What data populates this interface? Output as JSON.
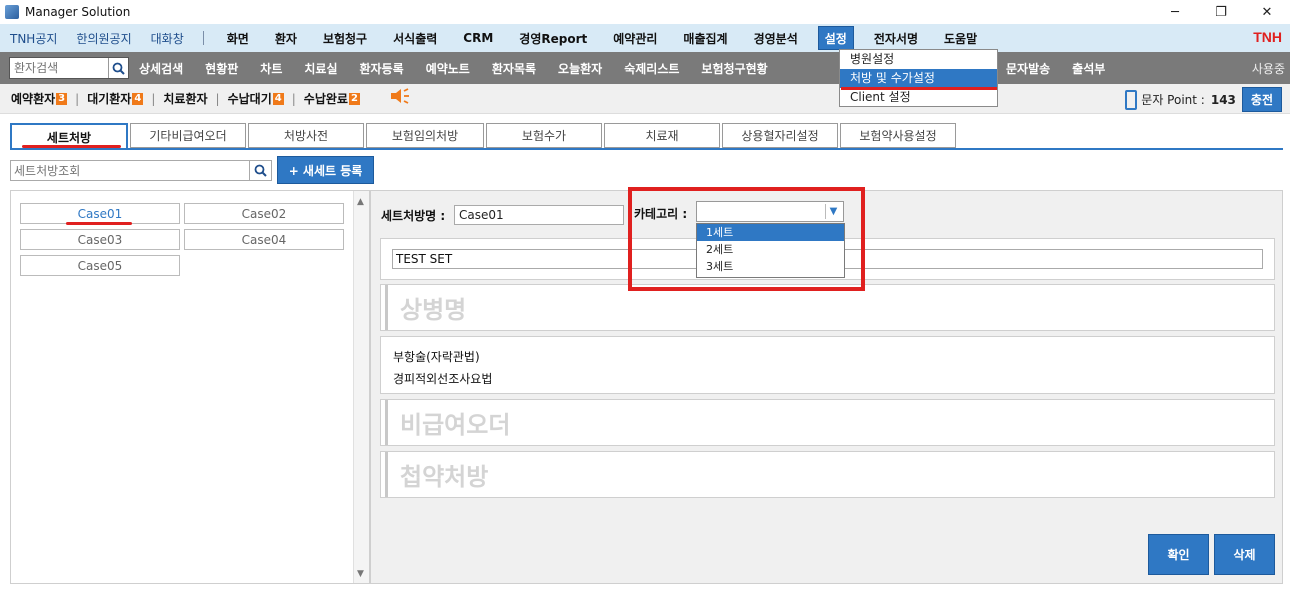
{
  "window": {
    "title": "Manager Solution",
    "controls": [
      "─",
      "❐",
      "✕"
    ]
  },
  "menubar": {
    "left_links": [
      "TNH공지",
      "한의원공지",
      "대화창"
    ],
    "main_items": [
      "화면",
      "환자",
      "보험청구",
      "서식출력",
      "CRM",
      "경영Report",
      "예약관리",
      "매출집계",
      "경영분석",
      "설정",
      "전자서명",
      "도움말"
    ],
    "active_item": "설정",
    "brand": "TNH"
  },
  "toolbar2": {
    "search_placeholder": "환자검색",
    "items": [
      "상세검색",
      "현황판",
      "차트",
      "치료실",
      "환자등록",
      "예약노트",
      "환자목록",
      "오늘환자",
      "숙제리스트",
      "보험청구현황"
    ],
    "right_items": [
      "문자발송",
      "출석부"
    ],
    "user_label": "사용중"
  },
  "settings_dropdown": {
    "items": [
      "병원설정",
      "처방 및 수가설정",
      "Client 설정"
    ],
    "selected_index": 1
  },
  "statusbar": {
    "items": [
      {
        "label": "예약환자",
        "badge": "3"
      },
      {
        "label": "대기환자",
        "badge": "4"
      },
      {
        "label": "치료환자",
        "badge": ""
      },
      {
        "label": "수납대기",
        "badge": "4"
      },
      {
        "label": "수납완료",
        "badge": "2"
      }
    ],
    "sms_label": "문자 Point :",
    "sms_value": "143",
    "charge_label": "충전"
  },
  "tabs": [
    "세트처방",
    "기타비급여오더",
    "처방사전",
    "보험임의처방",
    "보험수가",
    "치료재",
    "상용혈자리설정",
    "보험약사용설정"
  ],
  "active_tab": "세트처방",
  "set_search": {
    "placeholder": "세트처방조회",
    "new_button": "+ 새세트 등록"
  },
  "cases": [
    "Case01",
    "Case02",
    "Case03",
    "Case04",
    "Case05"
  ],
  "active_case": "Case01",
  "detail": {
    "name_label": "세트처방명 :",
    "name_value": "Case01",
    "category_label": "카테고리 :",
    "category_value": "",
    "category_options": [
      "1세트",
      "2세트",
      "3세트"
    ],
    "category_selected_index": 0,
    "set_text": "TEST SET",
    "disease_label": "상병명",
    "procedures": [
      "부항술(자락관법)",
      "경피적외선조사요법"
    ],
    "nonbenefit_label": "비급여오더",
    "herbal_label": "첩약처방"
  },
  "buttons": {
    "confirm": "확인",
    "delete": "삭제"
  },
  "colors": {
    "accent": "#2f78c4",
    "highlight": "#e0201f",
    "badge": "#f07a1a",
    "menubar_bg": "#d8eaf6",
    "toolbar_bg": "#7a7a7a"
  }
}
